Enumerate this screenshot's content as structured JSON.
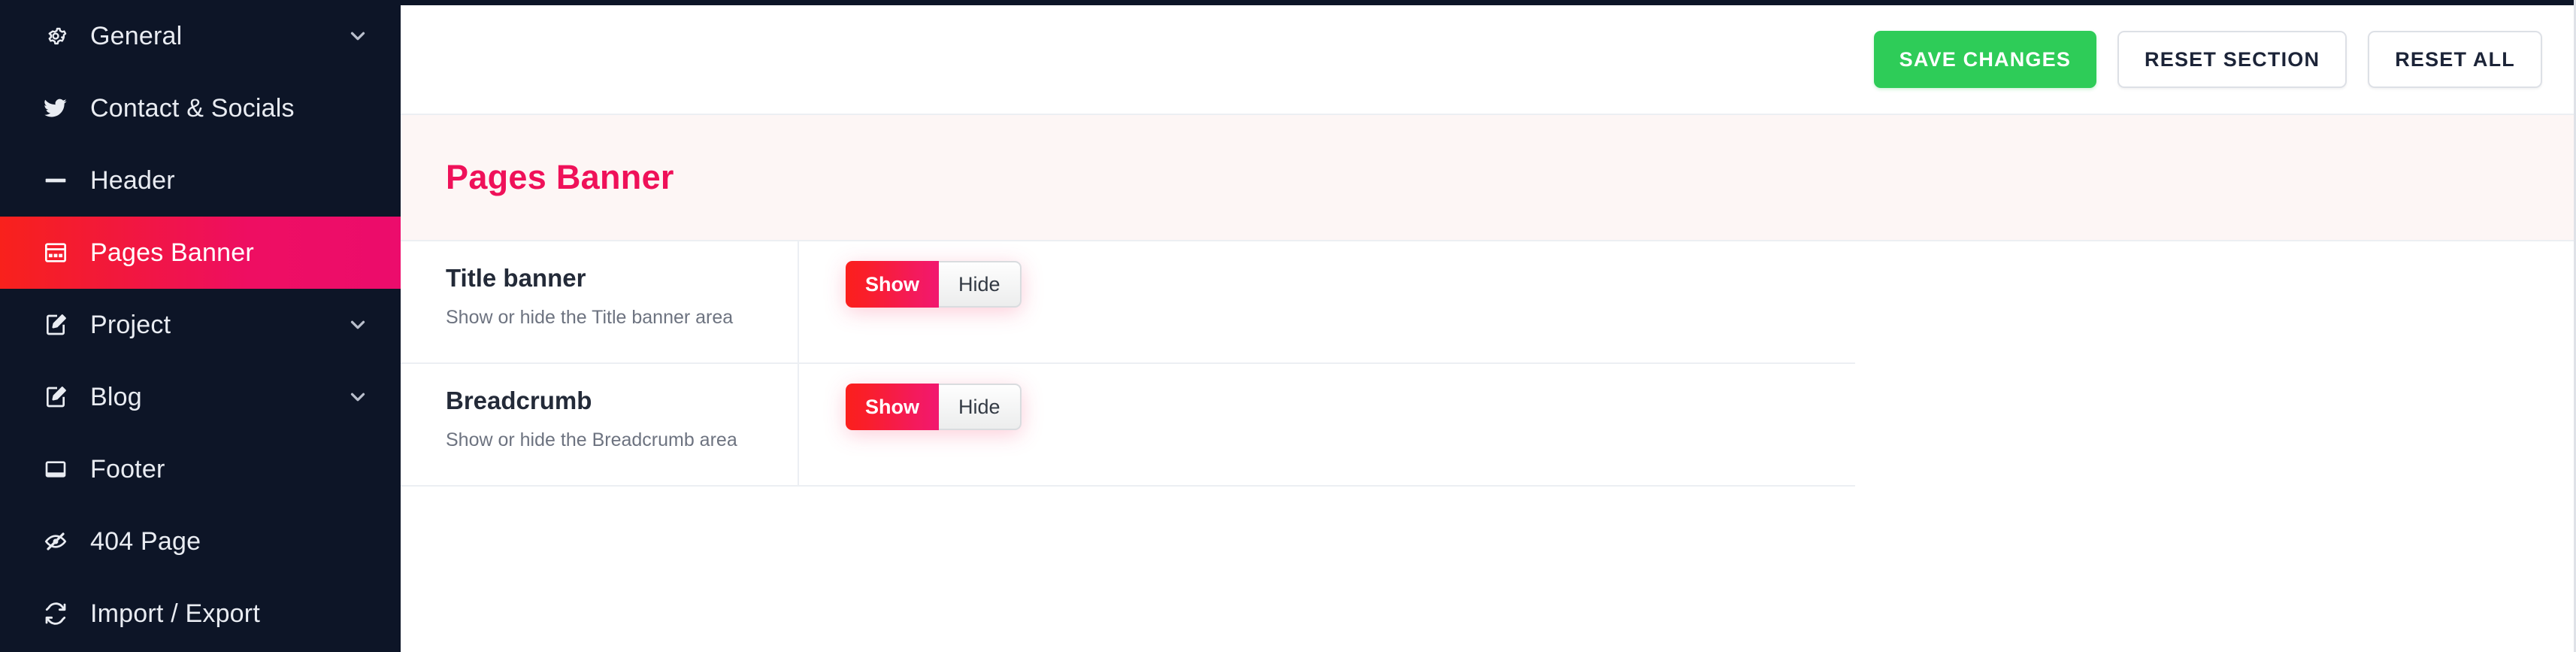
{
  "sidebar": {
    "items": [
      {
        "label": "General",
        "icon": "gear-icon",
        "has_chevron": true,
        "active": false
      },
      {
        "label": "Contact & Socials",
        "icon": "twitter-bird-icon",
        "has_chevron": false,
        "active": false
      },
      {
        "label": "Header",
        "icon": "header-bar-icon",
        "has_chevron": false,
        "active": false
      },
      {
        "label": "Pages Banner",
        "icon": "banner-layout-icon",
        "has_chevron": false,
        "active": true
      },
      {
        "label": "Project",
        "icon": "edit-document-icon",
        "has_chevron": true,
        "active": false
      },
      {
        "label": "Blog",
        "icon": "edit-document-icon",
        "has_chevron": true,
        "active": false
      },
      {
        "label": "Footer",
        "icon": "footer-window-icon",
        "has_chevron": false,
        "active": false
      },
      {
        "label": "404 Page",
        "icon": "eye-slash-icon",
        "has_chevron": false,
        "active": false
      },
      {
        "label": "Import / Export",
        "icon": "sync-arrows-icon",
        "has_chevron": false,
        "active": false
      }
    ]
  },
  "toolbar": {
    "save_label": "SAVE CHANGES",
    "reset_section_label": "RESET SECTION",
    "reset_all_label": "RESET ALL"
  },
  "section": {
    "title": "Pages Banner"
  },
  "rows": [
    {
      "title": "Title banner",
      "description": "Show or hide the Title banner area",
      "on_label": "Show",
      "off_label": "Hide",
      "selected": "Show"
    },
    {
      "title": "Breadcrumb",
      "description": "Show or hide the Breadcrumb area",
      "on_label": "Show",
      "off_label": "Hide",
      "selected": "Show"
    }
  ],
  "colors": {
    "sidebar_bg": "#0d1527",
    "accent_pink": "#ef1159",
    "accent_red": "#fb1f1c",
    "save_green": "#2ecc58",
    "section_band_bg": "#fdf6f5",
    "text_dark": "#232a38",
    "text_muted": "#6d7380"
  }
}
